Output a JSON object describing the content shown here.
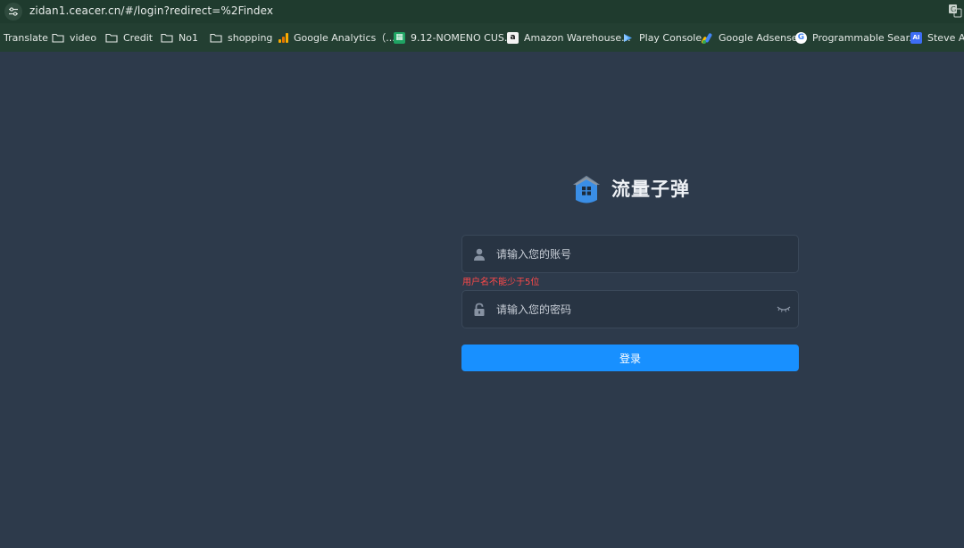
{
  "browser": {
    "url": "zidan1.ceacer.cn/#/login?redirect=%2Findex",
    "bookmarks": [
      {
        "label": "Translate",
        "icon": "none"
      },
      {
        "label": "video",
        "icon": "folder-icon"
      },
      {
        "label": "Credit",
        "icon": "folder-icon"
      },
      {
        "label": "No1",
        "icon": "folder-icon"
      },
      {
        "label": "shopping",
        "icon": "folder-icon"
      },
      {
        "label": "Google Analytics（...",
        "icon": "analytics-icon"
      },
      {
        "label": "9.12-NOMENO CUS...",
        "icon": "sheets-icon"
      },
      {
        "label": "Amazon Warehouse...",
        "icon": "amazon-icon"
      },
      {
        "label": "Play Console",
        "icon": "play-console-icon"
      },
      {
        "label": "Google Adsense",
        "icon": "adsense-icon"
      },
      {
        "label": "Programmable Sear...",
        "icon": "google-icon"
      },
      {
        "label": "Steve AI",
        "icon": "steve-ai-icon"
      }
    ]
  },
  "login": {
    "brand": "流量子弹",
    "username_placeholder": "请输入您的账号",
    "username_value": "",
    "username_error": "用户名不能少于5位",
    "password_placeholder": "请输入您的密码",
    "password_value": "",
    "submit_label": "登录"
  },
  "colors": {
    "background": "#2d3a4b",
    "primary": "#1890ff",
    "error": "#ff4949"
  }
}
